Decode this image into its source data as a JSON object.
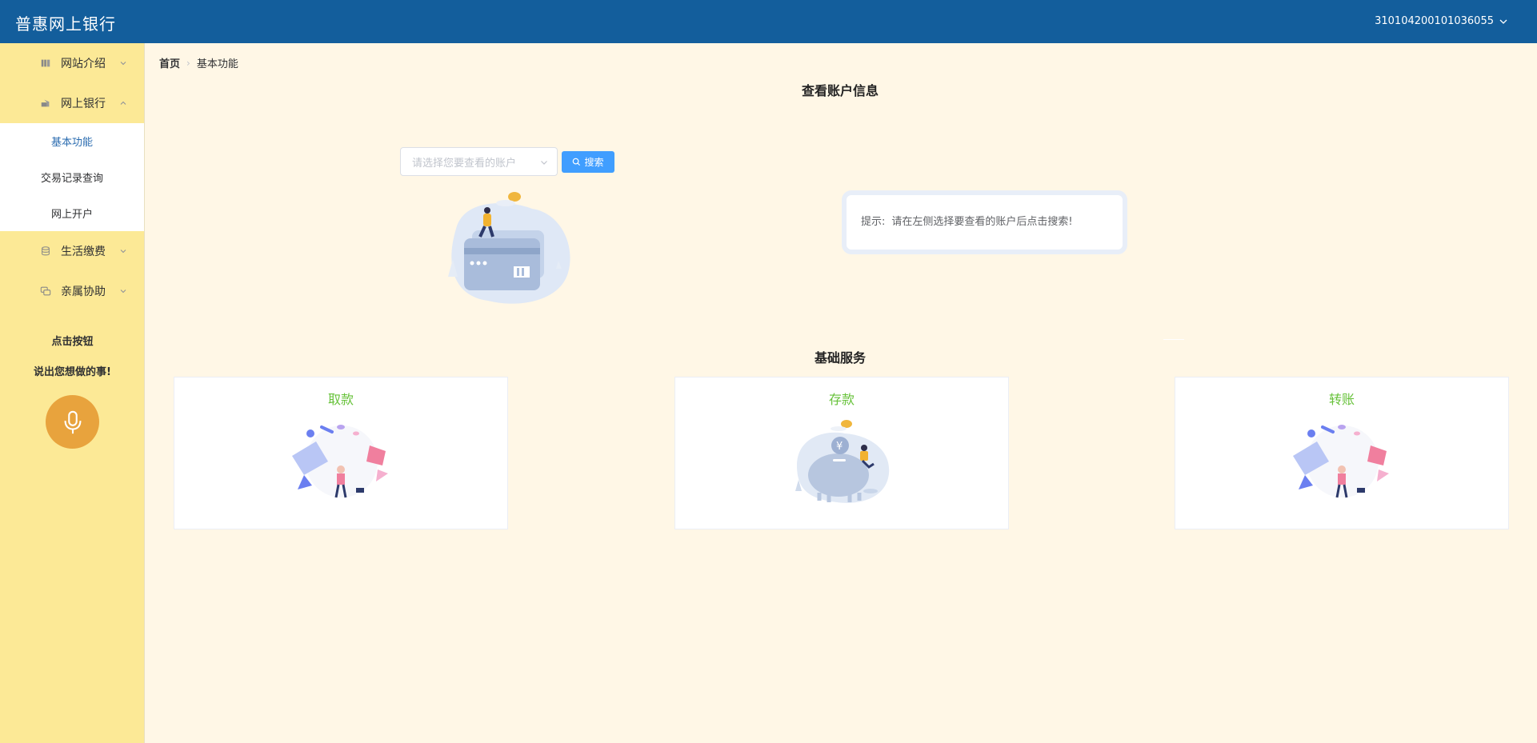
{
  "header": {
    "title": "普惠网上银行",
    "account": "310104200101036055"
  },
  "sidebar": {
    "menu": [
      {
        "label": "网站介绍",
        "icon": "book-icon"
      },
      {
        "label": "网上银行",
        "icon": "bank-icon"
      },
      {
        "label": "生活缴费",
        "icon": "database-icon"
      },
      {
        "label": "亲属协助",
        "icon": "chat-icon"
      }
    ],
    "submenu": [
      {
        "label": "基本功能"
      },
      {
        "label": "交易记录查询"
      },
      {
        "label": "网上开户"
      }
    ],
    "voice": {
      "line1": "点击按钮",
      "line2": "说出您想做的事!"
    }
  },
  "breadcrumb": {
    "home": "首页",
    "current": "基本功能"
  },
  "account_section": {
    "title": "查看账户信息",
    "select_placeholder": "请选择您要查看的账户",
    "search_label": "搜索",
    "tip_label": "提示:",
    "tip_text": "请在左侧选择要查看的账户后点击搜索!"
  },
  "services": {
    "title": "基础服务",
    "cards": [
      {
        "label": "取款"
      },
      {
        "label": "存款"
      },
      {
        "label": "转账"
      }
    ]
  },
  "colors": {
    "header": "#135e9c",
    "sidebar": "#fce996",
    "background": "#fff7e6",
    "accent": "#409eff",
    "service_title": "#67c23a",
    "mic": "#e8a33d"
  }
}
